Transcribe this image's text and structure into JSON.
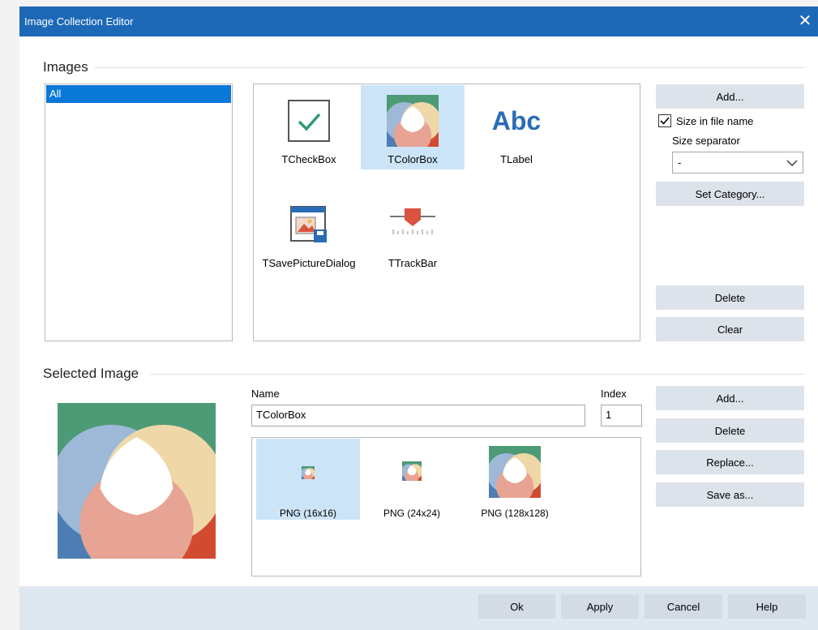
{
  "window": {
    "title": "Image Collection Editor",
    "close_label": "✕"
  },
  "images_group": {
    "title": "Images",
    "categories": [
      "All"
    ],
    "items": [
      {
        "label": "TCheckBox",
        "icon": "checkbox-icon",
        "selected": false
      },
      {
        "label": "TColorBox",
        "icon": "colorbox-icon",
        "selected": true
      },
      {
        "label": "TLabel",
        "icon": "label-abc-icon",
        "selected": false,
        "icon_text": "Abc"
      },
      {
        "label": "TSavePictureDialog",
        "icon": "save-picture-dialog-icon",
        "selected": false
      },
      {
        "label": "TTrackBar",
        "icon": "trackbar-icon",
        "selected": false
      }
    ],
    "buttons": {
      "add": "Add...",
      "set_category": "Set Category...",
      "delete": "Delete",
      "clear": "Clear"
    },
    "size_in_file_name": {
      "label": "Size in file name",
      "checked": true
    },
    "size_separator": {
      "label": "Size separator",
      "value": "-"
    }
  },
  "selected_group": {
    "title": "Selected Image",
    "name_label": "Name",
    "name_value": "TColorBox",
    "index_label": "Index",
    "index_value": "1",
    "variants": [
      {
        "label": "PNG (16x16)",
        "selected": true
      },
      {
        "label": "PNG (24x24)",
        "selected": false
      },
      {
        "label": "PNG (128x128)",
        "selected": false
      }
    ],
    "buttons": {
      "add": "Add...",
      "delete": "Delete",
      "replace": "Replace...",
      "save_as": "Save as..."
    }
  },
  "footer": {
    "ok": "Ok",
    "apply": "Apply",
    "cancel": "Cancel",
    "help": "Help"
  },
  "colors": {
    "title_bar": "#1d69b8",
    "selection": "#0a78d7",
    "tile_selected": "#cce4f7",
    "button": "#dde3ea",
    "footer": "#dfe7f1",
    "check_green": "#2e9b74",
    "abc_blue": "#2b6cb7",
    "trackbar_red": "#d9533f"
  }
}
